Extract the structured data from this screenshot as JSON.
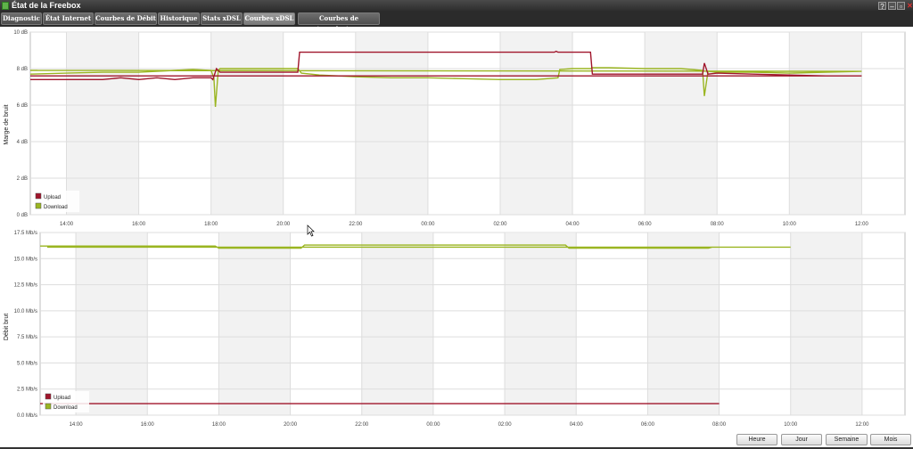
{
  "window": {
    "title": "État de la Freebox",
    "help": "?",
    "minimize": "–",
    "restore": "▫",
    "close": "✕"
  },
  "tabs": [
    {
      "label": "Diagnostic"
    },
    {
      "label": "État Internet"
    },
    {
      "label": "Courbes de Débit"
    },
    {
      "label": "Historique"
    },
    {
      "label": "Stats xDSL"
    },
    {
      "label": "Courbes xDSL",
      "active": true
    },
    {
      "label": "Courbes de température"
    }
  ],
  "buttons": {
    "hour": "Heure",
    "day": "Jour",
    "week": "Semaine",
    "month": "Mois"
  },
  "colors": {
    "upload": "#a0152b",
    "download": "#9ab521",
    "grid": "#dddddd",
    "band": "#f2f2f2"
  },
  "chart_data": [
    {
      "type": "line",
      "ylabel": "Marge de bruit",
      "yunit": "dB",
      "ylim": [
        0,
        10
      ],
      "yticks": [
        "0 dB",
        "2 dB",
        "4 dB",
        "6 dB",
        "8 dB",
        "10 dB"
      ],
      "xlabels": [
        "14:00",
        "16:00",
        "18:00",
        "20:00",
        "22:00",
        "00:00",
        "02:00",
        "04:00",
        "06:00",
        "08:00",
        "10:00",
        "12:00"
      ],
      "xlim": [
        13.0,
        37.2
      ],
      "legend_position": "bottom-left",
      "series": [
        {
          "name": "Upload",
          "color": "#a0152b",
          "points": [
            [
              13.0,
              7.4
            ],
            [
              14.0,
              7.4
            ],
            [
              15.0,
              7.4
            ],
            [
              15.5,
              7.5
            ],
            [
              16.0,
              7.4
            ],
            [
              16.5,
              7.5
            ],
            [
              17.0,
              7.4
            ],
            [
              17.5,
              7.5
            ],
            [
              18.0,
              7.5
            ],
            [
              18.05,
              7.4
            ],
            [
              18.15,
              8.0
            ],
            [
              18.25,
              7.8
            ],
            [
              19.0,
              7.8
            ],
            [
              20.0,
              7.8
            ],
            [
              20.4,
              7.8
            ],
            [
              20.45,
              8.9
            ],
            [
              21.0,
              8.9
            ],
            [
              22.0,
              8.9
            ],
            [
              23.0,
              8.9
            ],
            [
              0.0,
              8.9
            ],
            [
              1.0,
              8.9
            ],
            [
              2.0,
              8.9
            ],
            [
              3.0,
              8.9
            ],
            [
              3.5,
              8.9
            ],
            [
              3.55,
              8.95
            ],
            [
              3.6,
              8.9
            ],
            [
              4.0,
              8.9
            ],
            [
              4.5,
              8.9
            ],
            [
              4.55,
              7.7
            ],
            [
              5.0,
              7.7
            ],
            [
              6.0,
              7.7
            ],
            [
              7.0,
              7.7
            ],
            [
              7.6,
              7.7
            ],
            [
              7.65,
              8.3
            ],
            [
              7.75,
              7.7
            ],
            [
              8.0,
              7.75
            ],
            [
              9.0,
              7.7
            ],
            [
              10.0,
              7.65
            ],
            [
              11.0,
              7.6
            ],
            [
              12.0,
              7.6
            ],
            [
              13.0,
              7.6
            ],
            [
              13.2,
              7.6
            ]
          ]
        },
        {
          "name": "Download",
          "color": "#9ab521",
          "points": [
            [
              13.0,
              7.7
            ],
            [
              14.0,
              7.75
            ],
            [
              15.0,
              7.8
            ],
            [
              16.0,
              7.8
            ],
            [
              17.0,
              7.9
            ],
            [
              17.5,
              7.95
            ],
            [
              18.0,
              7.9
            ],
            [
              18.08,
              7.5
            ],
            [
              18.12,
              5.9
            ],
            [
              18.2,
              7.9
            ],
            [
              18.25,
              8.0
            ],
            [
              19.0,
              8.0
            ],
            [
              20.0,
              8.0
            ],
            [
              20.4,
              8.0
            ],
            [
              20.5,
              7.75
            ],
            [
              21.0,
              7.65
            ],
            [
              22.0,
              7.55
            ],
            [
              23.0,
              7.5
            ],
            [
              0.0,
              7.5
            ],
            [
              1.0,
              7.45
            ],
            [
              2.0,
              7.4
            ],
            [
              3.0,
              7.4
            ],
            [
              3.6,
              7.5
            ],
            [
              3.65,
              7.95
            ],
            [
              4.0,
              8.0
            ],
            [
              4.5,
              8.0
            ],
            [
              4.55,
              8.05
            ],
            [
              5.0,
              8.05
            ],
            [
              6.0,
              8.0
            ],
            [
              7.0,
              8.0
            ],
            [
              7.6,
              7.9
            ],
            [
              7.65,
              6.5
            ],
            [
              7.75,
              7.85
            ],
            [
              8.0,
              7.8
            ],
            [
              9.0,
              7.8
            ],
            [
              10.0,
              7.75
            ],
            [
              11.0,
              7.8
            ],
            [
              12.0,
              7.85
            ],
            [
              13.0,
              7.9
            ],
            [
              13.2,
              7.9
            ]
          ]
        }
      ]
    },
    {
      "type": "line",
      "ylabel": "Débit brut",
      "yunit": "Mb/s",
      "ylim": [
        0,
        17.5
      ],
      "yticks": [
        "0.0 Mb/s",
        "2.5 Mb/s",
        "5.0 Mb/s",
        "7.5 Mb/s",
        "10.0 Mb/s",
        "12.5 Mb/s",
        "15.0 Mb/s",
        "17.5 Mb/s"
      ],
      "xlabels": [
        "14:00",
        "16:00",
        "18:00",
        "20:00",
        "22:00",
        "00:00",
        "02:00",
        "04:00",
        "06:00",
        "08:00",
        "10:00",
        "12:00"
      ],
      "xlim": [
        13.0,
        37.2
      ],
      "legend_position": "bottom-left",
      "series": [
        {
          "name": "Upload",
          "color": "#a0152b",
          "points": [
            [
              13.0,
              1.1
            ],
            [
              20.0,
              1.1
            ],
            [
              0.0,
              1.1
            ],
            [
              4.0,
              1.1
            ],
            [
              8.0,
              1.1
            ],
            [
              13.2,
              1.1
            ]
          ]
        },
        {
          "name": "Download",
          "color": "#9ab521",
          "points": [
            [
              13.0,
              16.2
            ],
            [
              17.9,
              16.2
            ],
            [
              18.0,
              16.0
            ],
            [
              20.3,
              16.0
            ],
            [
              20.4,
              16.3
            ],
            [
              23.0,
              16.3
            ],
            [
              0.0,
              16.3
            ],
            [
              2.0,
              16.3
            ],
            [
              3.7,
              16.3
            ],
            [
              3.8,
              16.0
            ],
            [
              7.7,
              16.0
            ],
            [
              7.8,
              16.1
            ],
            [
              10.0,
              16.1
            ],
            [
              13.2,
              16.1
            ]
          ]
        }
      ]
    }
  ]
}
